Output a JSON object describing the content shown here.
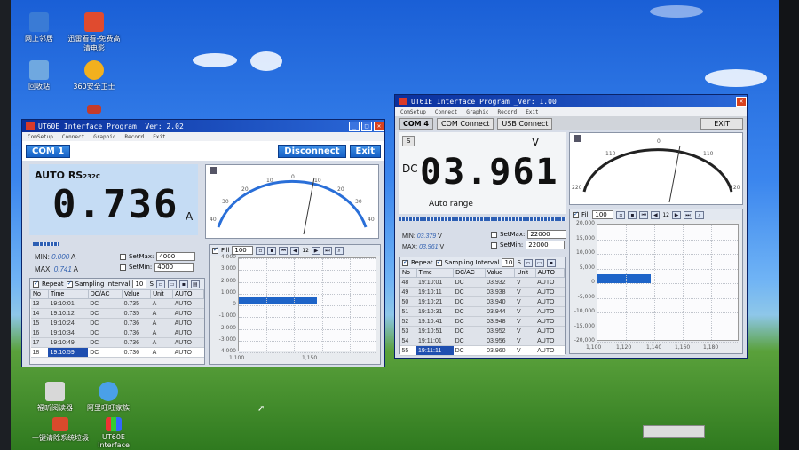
{
  "desktop": {
    "icons": [
      {
        "label": "网上邻居"
      },
      {
        "label": "迅雷看看-免费高清电影"
      },
      {
        "label": "回收站"
      },
      {
        "label": "360安全卫士"
      },
      {
        "label": "福昕阅读器"
      },
      {
        "label": "阿里旺旺家族"
      },
      {
        "label": "一键清除系统垃圾"
      },
      {
        "label": "UT60E Interface"
      }
    ]
  },
  "win1": {
    "title": "UT60E Interface Program _Ver: 2.02",
    "menu": [
      "ComSetup",
      "Connect",
      "Graphic",
      "Record",
      "Exit"
    ],
    "com_label": "COM 1",
    "disconnect_label": "Disconnect",
    "exit_label": "Exit",
    "lcd_mode": "AUTO",
    "lcd_rs": "RS",
    "lcd_rs_sub": "232C",
    "lcd_value": "0.736",
    "lcd_unit": "A",
    "min_label": "MIN:",
    "min_value": "0.000",
    "min_unit": "A",
    "max_label": "MAX:",
    "max_value": "0.741",
    "max_unit": "A",
    "setmax_label": "SetMax:",
    "setmax_value": "4000",
    "setmin_label": "SetMin:",
    "setmin_value": "4000",
    "meter_scale": [
      "40",
      "30",
      "20",
      "10",
      "0",
      "10",
      "20",
      "30",
      "40"
    ],
    "repeat_label": "Repeat",
    "interval_label": "Sampling Interval",
    "interval_value": "10",
    "interval_unit": "S",
    "table_headers": [
      "No",
      "Time",
      "DC/AC",
      "Value",
      "Unit",
      "AUTO"
    ],
    "rows": [
      [
        "13",
        "19:10:01",
        "DC",
        "0.735",
        "A",
        "AUTO"
      ],
      [
        "14",
        "19:10:12",
        "DC",
        "0.735",
        "A",
        "AUTO"
      ],
      [
        "15",
        "19:10:24",
        "DC",
        "0.736",
        "A",
        "AUTO"
      ],
      [
        "16",
        "19:10:34",
        "DC",
        "0.736",
        "A",
        "AUTO"
      ],
      [
        "17",
        "19:10:49",
        "DC",
        "0.736",
        "A",
        "AUTO"
      ],
      [
        "18",
        "19:10:59",
        "DC",
        "0.736",
        "A",
        "AUTO"
      ]
    ],
    "graph_fill_label": "Fill",
    "graph_count": "100",
    "graph_page": "12",
    "graph_yticks": [
      "4,000",
      "3,000",
      "2,000",
      "1,000",
      "0",
      "-1,000",
      "-2,000",
      "-3,000",
      "-4,000"
    ],
    "graph_xticks": [
      "1,100",
      "1,150"
    ]
  },
  "win2": {
    "title": "UT61E Interface Program _Ver: 1.00",
    "menu": [
      "ComSetup",
      "Connect",
      "Graphic",
      "Record",
      "Exit"
    ],
    "com_label": "COM 4",
    "com_connect_label": "COM Connect",
    "usb_connect_label": "USB Connect",
    "exit_label": "EXIT",
    "s_label": "S",
    "lcd_dc": "DC",
    "lcd_value": "03.961",
    "lcd_unit": "V",
    "lcd_mode": "Auto range",
    "min_label": "MIN:",
    "min_value": "03.379",
    "min_unit": "V",
    "max_label": "MAX:",
    "max_value": "03.961",
    "max_unit": "V",
    "setmax_label": "SetMax:",
    "setmax_value": "22000",
    "setmin_label": "SetMin:",
    "setmin_value": "22000",
    "meter_scale": [
      "220",
      "110",
      "0",
      "110",
      "220"
    ],
    "repeat_label": "Repeat",
    "interval_label": "Sampling Interval",
    "interval_value": "10",
    "interval_unit": "S",
    "table_headers": [
      "No",
      "Time",
      "DC/AC",
      "Value",
      "Unit",
      "AUTO"
    ],
    "rows": [
      [
        "48",
        "19:10:01",
        "DC",
        "03.932",
        "V",
        "AUTO"
      ],
      [
        "49",
        "19:10:11",
        "DC",
        "03.938",
        "V",
        "AUTO"
      ],
      [
        "50",
        "19:10:21",
        "DC",
        "03.940",
        "V",
        "AUTO"
      ],
      [
        "51",
        "19:10:31",
        "DC",
        "03.944",
        "V",
        "AUTO"
      ],
      [
        "52",
        "19:10:41",
        "DC",
        "03.948",
        "V",
        "AUTO"
      ],
      [
        "53",
        "19:10:51",
        "DC",
        "03.952",
        "V",
        "AUTO"
      ],
      [
        "54",
        "19:11:01",
        "DC",
        "03.956",
        "V",
        "AUTO"
      ],
      [
        "55",
        "19:11:11",
        "DC",
        "03.960",
        "V",
        "AUTO"
      ]
    ],
    "graph_fill_label": "Fill",
    "graph_count": "100",
    "graph_page": "12",
    "graph_yticks": [
      "20,000",
      "15,000",
      "10,000",
      "5,000",
      "0",
      "-5,000",
      "-10,000",
      "-15,000",
      "-20,000"
    ],
    "graph_xticks": [
      "1,100",
      "1,120",
      "1,140",
      "1,160",
      "1,180"
    ]
  },
  "colors": {
    "title_bar": "#0a2f9c",
    "lcd_bg": "#c5dcf4",
    "trace": "#1e64c8"
  }
}
